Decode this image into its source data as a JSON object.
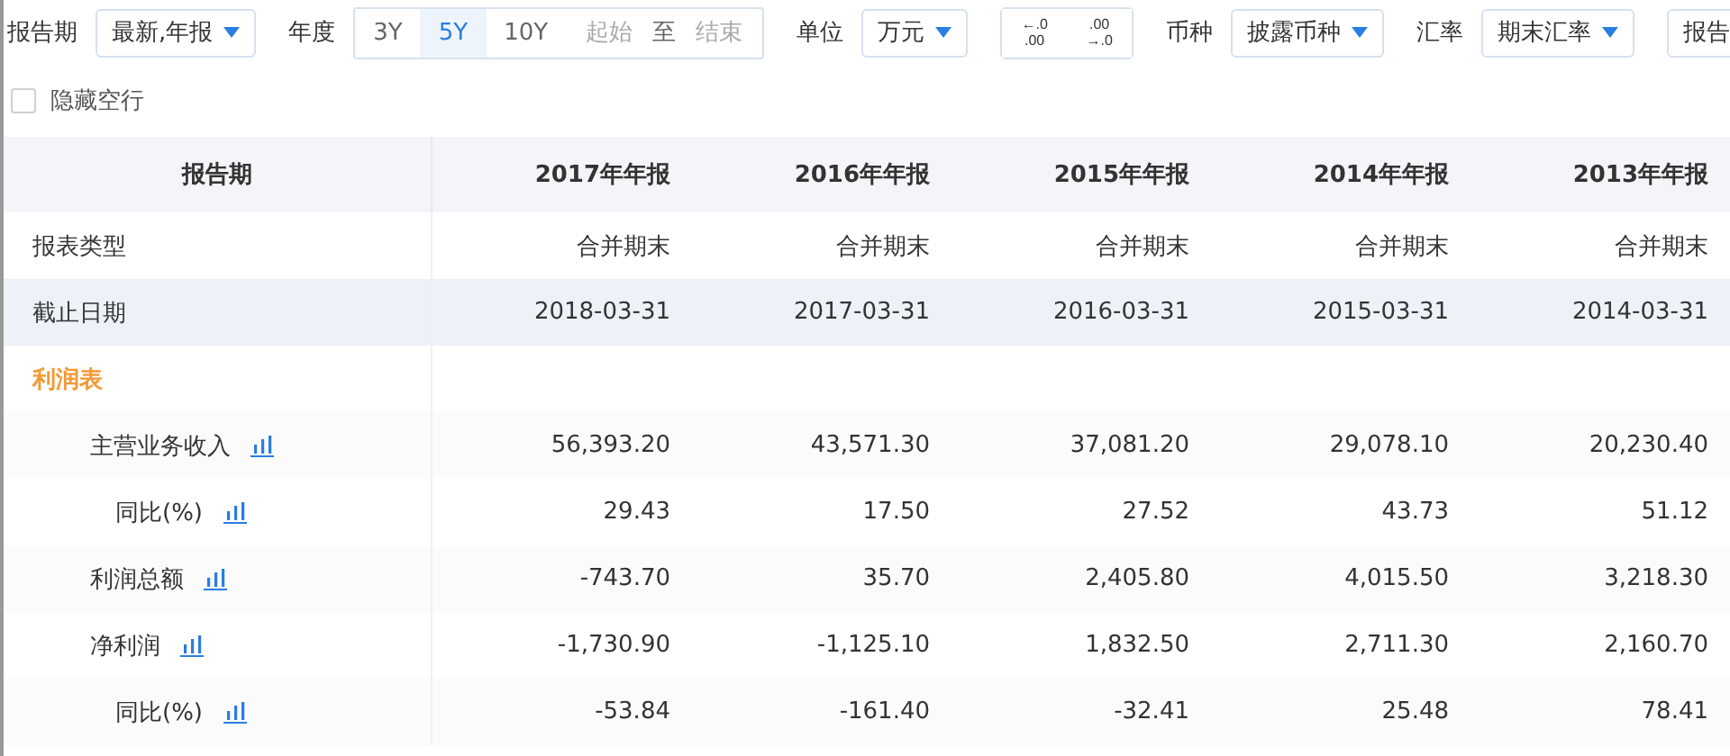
{
  "toolbar": [
    {
      "kind": "dropdown",
      "label": "报告期",
      "value": "最新,年报"
    },
    {
      "kind": "segmented",
      "label": "年度",
      "options": [
        {
          "text": "3Y",
          "selected": false
        },
        {
          "text": "5Y",
          "selected": true
        },
        {
          "text": "10Y",
          "selected": false
        }
      ],
      "start_placeholder": "起始",
      "separator": "至",
      "end_placeholder": "结束"
    },
    {
      "kind": "dropdown",
      "label": "单位",
      "value": "万元"
    },
    {
      "kind": "decimals",
      "buttons": [
        {
          "top": "←.0",
          "bottom": ".00"
        },
        {
          "top": ".00",
          "bottom": "→.0"
        }
      ]
    },
    {
      "kind": "dropdown",
      "label": "币种",
      "value": "披露币种"
    },
    {
      "kind": "dropdown",
      "label": "汇率",
      "value": "期末汇率"
    },
    {
      "kind": "button",
      "value": "报告"
    }
  ],
  "hide_empty_rows": {
    "label": "隐藏空行",
    "checked": false
  },
  "table": {
    "header": "报告期",
    "columns": [
      "2017年年报",
      "2016年年报",
      "2015年年报",
      "2014年年报",
      "2013年年报"
    ],
    "rows": [
      {
        "kind": "plain",
        "label": "报表类型",
        "values": [
          "合并期末",
          "合并期末",
          "合并期末",
          "合并期末",
          "合并期末"
        ]
      },
      {
        "kind": "highlight",
        "label": "截止日期",
        "values": [
          "2018-03-31",
          "2017-03-31",
          "2016-03-31",
          "2015-03-31",
          "2014-03-31"
        ]
      },
      {
        "kind": "section",
        "label": "利润表"
      },
      {
        "kind": "item",
        "label": "主营业务收入",
        "values": [
          "56,393.20",
          "43,571.30",
          "37,081.20",
          "29,078.10",
          "20,230.40"
        ],
        "children": [
          {
            "kind": "item",
            "label": "同比(%)",
            "values": [
              "29.43",
              "17.50",
              "27.52",
              "43.73",
              "51.12"
            ]
          }
        ]
      },
      {
        "kind": "item",
        "label": "利润总额",
        "values": [
          "-743.70",
          "35.70",
          "2,405.80",
          "4,015.50",
          "3,218.30"
        ]
      },
      {
        "kind": "item",
        "label": "净利润",
        "values": [
          "-1,730.90",
          "-1,125.10",
          "1,832.50",
          "2,711.30",
          "2,160.70"
        ],
        "children": [
          {
            "kind": "item",
            "label": "同比(%)",
            "values": [
              "-53.84",
              "-161.40",
              "-32.41",
              "25.48",
              "78.41"
            ]
          }
        ]
      }
    ]
  }
}
